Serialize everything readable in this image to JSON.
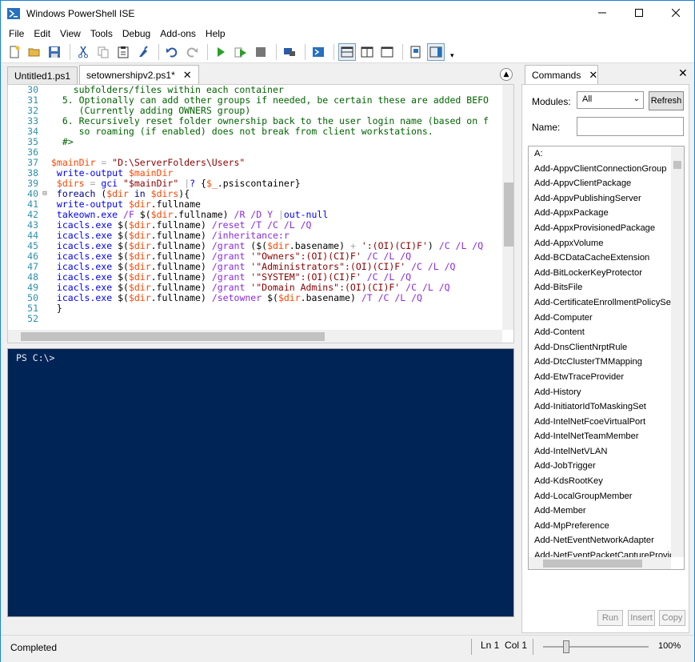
{
  "window": {
    "title": "Windows PowerShell ISE"
  },
  "menu": [
    "File",
    "Edit",
    "View",
    "Tools",
    "Debug",
    "Add-ons",
    "Help"
  ],
  "toolbar": {
    "icons": [
      "new-icon",
      "open-icon",
      "save-icon",
      "cut-icon",
      "copy-icon",
      "paste-icon",
      "clear-icon",
      "undo-icon",
      "redo-icon",
      "run-icon",
      "run-selection-icon",
      "stop-icon",
      "remote-icon",
      "powershell-icon",
      "layout-top-icon",
      "layout-right-icon",
      "layout-max-icon",
      "show-script-icon",
      "show-commands-icon"
    ]
  },
  "tabs": [
    {
      "label": "Untitled1.ps1",
      "active": false
    },
    {
      "label": "setownershipv2.ps1*",
      "active": true
    }
  ],
  "editor": {
    "lines": [
      {
        "n": "30",
        "fold": "",
        "seg": [
          [
            "c-cmt",
            "    subfolders/files within each container"
          ]
        ]
      },
      {
        "n": "31",
        "fold": "",
        "seg": [
          [
            "c-cmt",
            "  5. Optionally can add other groups if needed, be certain these are added BEFO"
          ]
        ]
      },
      {
        "n": "32",
        "fold": "",
        "seg": [
          [
            "c-cmt",
            "     (Currently adding OWNERS group)"
          ]
        ]
      },
      {
        "n": "33",
        "fold": "",
        "seg": [
          [
            "c-cmt",
            "  6. Recursively reset folder ownership back to the user login name (based on f"
          ]
        ]
      },
      {
        "n": "34",
        "fold": "",
        "seg": [
          [
            "c-cmt",
            "     so roaming (if enabled) does not break from client workstations."
          ]
        ]
      },
      {
        "n": "35",
        "fold": "",
        "seg": [
          [
            "c-cmt",
            "  #>"
          ]
        ]
      },
      {
        "n": "36",
        "fold": "",
        "seg": []
      },
      {
        "n": "37",
        "fold": "",
        "seg": [
          [
            "c-var",
            "$mainDir"
          ],
          [
            "c-op",
            " = "
          ],
          [
            "c-str",
            "\"D:\\ServerFolders\\Users\""
          ]
        ]
      },
      {
        "n": "38",
        "fold": "",
        "seg": [
          [
            "c-cmd",
            " write-output "
          ],
          [
            "c-var",
            "$mainDir"
          ]
        ]
      },
      {
        "n": "39",
        "fold": "",
        "seg": [
          [
            "c-var",
            " $dirs"
          ],
          [
            "c-op",
            " = "
          ],
          [
            "c-cmd",
            "gci "
          ],
          [
            "c-str",
            "\"$mainDir\""
          ],
          [
            "c-op",
            " |"
          ],
          [
            "c-cmd",
            "? "
          ],
          [
            "c-mem",
            "{"
          ],
          [
            "c-var",
            "$_"
          ],
          [
            "c-mem",
            ".psiscontainer}"
          ]
        ]
      },
      {
        "n": "40",
        "fold": "⊟",
        "seg": [
          [
            "c-kw",
            " foreach "
          ],
          [
            "c-mem",
            "("
          ],
          [
            "c-var",
            "$dir"
          ],
          [
            "c-kw",
            " in "
          ],
          [
            "c-var",
            "$dirs"
          ],
          [
            "c-mem",
            "){"
          ]
        ]
      },
      {
        "n": "41",
        "fold": "",
        "seg": [
          [
            "c-cmd",
            " write-output "
          ],
          [
            "c-var",
            "$dir"
          ],
          [
            "c-mem",
            ".fullname"
          ]
        ]
      },
      {
        "n": "42",
        "fold": "",
        "seg": [
          [
            "c-cmd",
            " takeown.exe "
          ],
          [
            "c-arg",
            "/F "
          ],
          [
            "c-mem",
            "$("
          ],
          [
            "c-var",
            "$dir"
          ],
          [
            "c-mem",
            ".fullname) "
          ],
          [
            "c-arg",
            "/R /D Y "
          ],
          [
            "c-op",
            "|"
          ],
          [
            "c-cmd",
            "out-null"
          ]
        ]
      },
      {
        "n": "43",
        "fold": "",
        "seg": [
          [
            "c-cmd",
            " icacls.exe "
          ],
          [
            "c-mem",
            "$("
          ],
          [
            "c-var",
            "$dir"
          ],
          [
            "c-mem",
            ".fullname) "
          ],
          [
            "c-arg",
            "/reset /T /C /L /Q"
          ]
        ]
      },
      {
        "n": "44",
        "fold": "",
        "seg": [
          [
            "c-cmd",
            " icacls.exe "
          ],
          [
            "c-mem",
            "$("
          ],
          [
            "c-var",
            "$dir"
          ],
          [
            "c-mem",
            ".fullname) "
          ],
          [
            "c-arg",
            "/inheritance:r"
          ]
        ]
      },
      {
        "n": "45",
        "fold": "",
        "seg": [
          [
            "c-cmd",
            " icacls.exe "
          ],
          [
            "c-mem",
            "$("
          ],
          [
            "c-var",
            "$dir"
          ],
          [
            "c-mem",
            ".fullname) "
          ],
          [
            "c-arg",
            "/grant "
          ],
          [
            "c-mem",
            "($("
          ],
          [
            "c-var",
            "$dir"
          ],
          [
            "c-mem",
            ".basename) "
          ],
          [
            "c-op",
            "+ "
          ],
          [
            "c-str",
            "':(OI)(CI)F'"
          ],
          [
            "c-mem",
            ") "
          ],
          [
            "c-arg",
            "/C /L /Q"
          ]
        ]
      },
      {
        "n": "46",
        "fold": "",
        "seg": [
          [
            "c-cmd",
            " icacls.exe "
          ],
          [
            "c-mem",
            "$("
          ],
          [
            "c-var",
            "$dir"
          ],
          [
            "c-mem",
            ".fullname) "
          ],
          [
            "c-arg",
            "/grant "
          ],
          [
            "c-str",
            "'\"Owners\":(OI)(CI)F' "
          ],
          [
            "c-arg",
            "/C /L /Q"
          ]
        ]
      },
      {
        "n": "47",
        "fold": "",
        "seg": [
          [
            "c-cmd",
            " icacls.exe "
          ],
          [
            "c-mem",
            "$("
          ],
          [
            "c-var",
            "$dir"
          ],
          [
            "c-mem",
            ".fullname) "
          ],
          [
            "c-arg",
            "/grant "
          ],
          [
            "c-str",
            "'\"Administrators\":(OI)(CI)F' "
          ],
          [
            "c-arg",
            "/C /L /Q"
          ]
        ]
      },
      {
        "n": "48",
        "fold": "",
        "seg": [
          [
            "c-cmd",
            " icacls.exe "
          ],
          [
            "c-mem",
            "$("
          ],
          [
            "c-var",
            "$dir"
          ],
          [
            "c-mem",
            ".fullname) "
          ],
          [
            "c-arg",
            "/grant "
          ],
          [
            "c-str",
            "'\"SYSTEM\":(OI)(CI)F' "
          ],
          [
            "c-arg",
            "/C /L /Q"
          ]
        ]
      },
      {
        "n": "49",
        "fold": "",
        "seg": [
          [
            "c-cmd",
            " icacls.exe "
          ],
          [
            "c-mem",
            "$("
          ],
          [
            "c-var",
            "$dir"
          ],
          [
            "c-mem",
            ".fullname) "
          ],
          [
            "c-arg",
            "/grant "
          ],
          [
            "c-str",
            "'\"Domain Admins\":(OI)(CI)F' "
          ],
          [
            "c-arg",
            "/C /L /Q"
          ]
        ]
      },
      {
        "n": "50",
        "fold": "",
        "seg": [
          [
            "c-cmd",
            " icacls.exe "
          ],
          [
            "c-mem",
            "$("
          ],
          [
            "c-var",
            "$dir"
          ],
          [
            "c-mem",
            ".fullname) "
          ],
          [
            "c-arg",
            "/setowner "
          ],
          [
            "c-mem",
            "$("
          ],
          [
            "c-var",
            "$dir"
          ],
          [
            "c-mem",
            ".basename) "
          ],
          [
            "c-arg",
            "/T /C /L /Q"
          ]
        ]
      },
      {
        "n": "51",
        "fold": "",
        "seg": [
          [
            "c-mem",
            " }"
          ]
        ]
      },
      {
        "n": "52",
        "fold": "",
        "seg": []
      }
    ]
  },
  "console": {
    "prompt": "PS C:\\>"
  },
  "commands": {
    "tab_label": "Commands",
    "modules_label": "Modules:",
    "modules_value": "All",
    "refresh_label": "Refresh",
    "name_label": "Name:",
    "items": [
      "A:",
      "Add-AppvClientConnectionGroup",
      "Add-AppvClientPackage",
      "Add-AppvPublishingServer",
      "Add-AppxPackage",
      "Add-AppxProvisionedPackage",
      "Add-AppxVolume",
      "Add-BCDataCacheExtension",
      "Add-BitLockerKeyProtector",
      "Add-BitsFile",
      "Add-CertificateEnrollmentPolicyServer",
      "Add-Computer",
      "Add-Content",
      "Add-DnsClientNrptRule",
      "Add-DtcClusterTMMapping",
      "Add-EtwTraceProvider",
      "Add-History",
      "Add-InitiatorIdToMaskingSet",
      "Add-IntelNetFcoeVirtualPort",
      "Add-IntelNetTeamMember",
      "Add-IntelNetVLAN",
      "Add-JobTrigger",
      "Add-KdsRootKey",
      "Add-LocalGroupMember",
      "Add-Member",
      "Add-MpPreference",
      "Add-NetEventNetworkAdapter",
      "Add-NetEventPacketCaptureProvider"
    ],
    "run_label": "Run",
    "insert_label": "Insert",
    "copy_label": "Copy"
  },
  "status": {
    "text": "Completed",
    "position": "Ln 1  Col 1",
    "zoom": "100%"
  }
}
